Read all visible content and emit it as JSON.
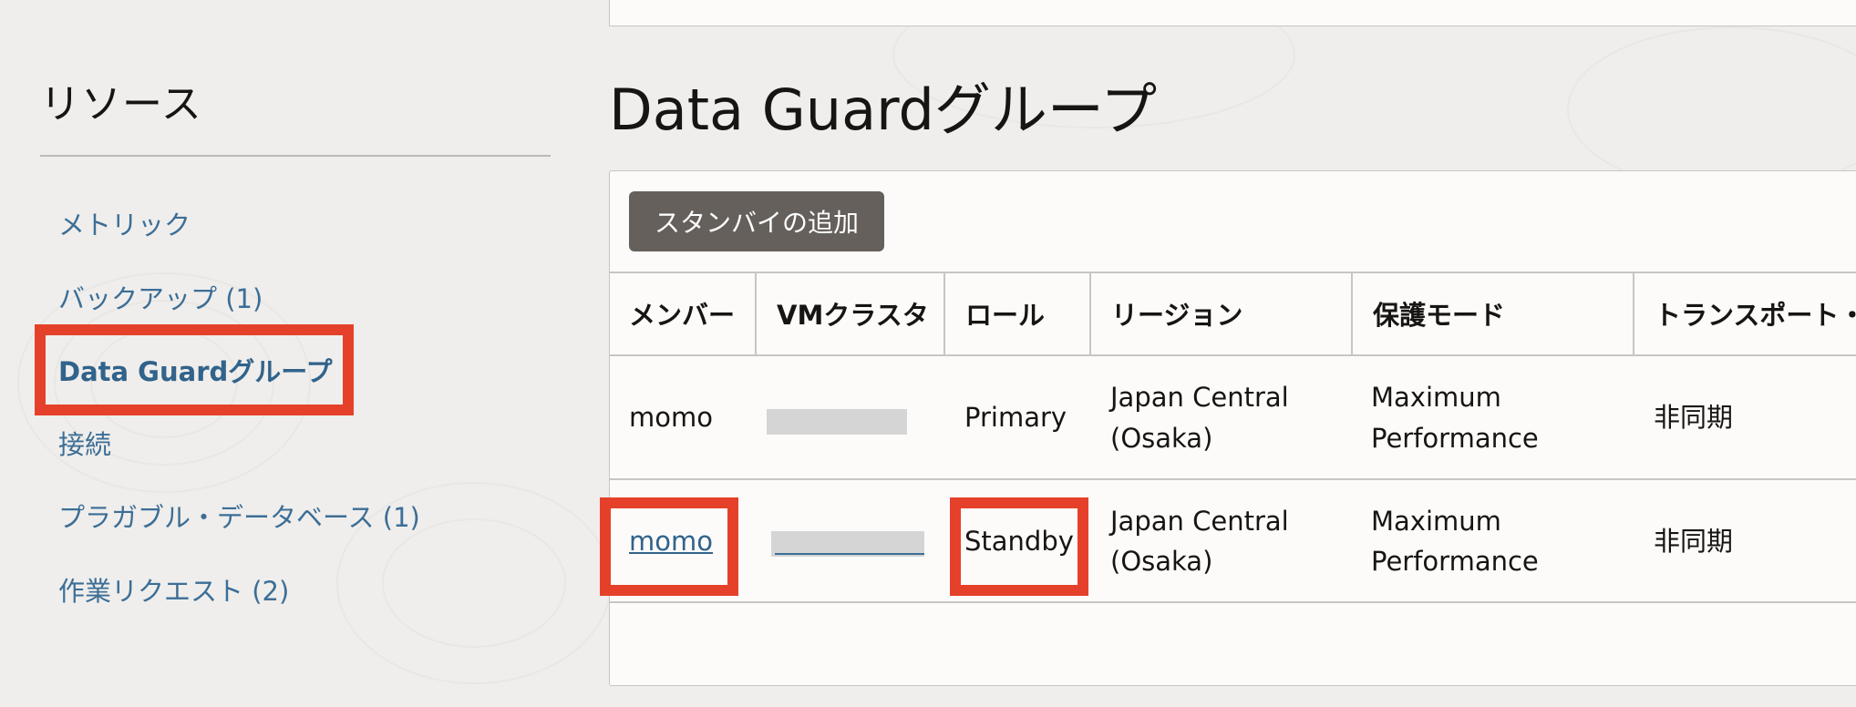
{
  "sidebar": {
    "title": "リソース",
    "items": [
      {
        "label": "メトリック"
      },
      {
        "label": "バックアップ (1)"
      },
      {
        "label": "Data Guardグループ",
        "active": true
      },
      {
        "label": "接続"
      },
      {
        "label": "プラガブル・データベース (1)"
      },
      {
        "label": "作業リクエスト (2)"
      }
    ]
  },
  "main": {
    "title": "Data Guardグループ",
    "add_button_label": "スタンバイの追加",
    "table": {
      "columns": [
        "メンバー",
        "VMクラスタ",
        "ロール",
        "リージョン",
        "保護モード",
        "トランスポート・タ"
      ],
      "rows": [
        {
          "member": "momo",
          "member_link": false,
          "vm_cluster": "",
          "role": "Primary",
          "region_l1": "Japan Central",
          "region_l2": "(Osaka)",
          "mode_l1": "Maximum",
          "mode_l2": "Performance",
          "transport": "非同期"
        },
        {
          "member": "momo",
          "member_link": true,
          "vm_cluster": "",
          "role": "Standby",
          "region_l1": "Japan Central",
          "region_l2": "(Osaka)",
          "mode_l1": "Maximum",
          "mode_l2": "Performance",
          "transport": "非同期"
        }
      ]
    }
  },
  "colors": {
    "highlight": "#e5412a",
    "link": "#31638b",
    "button": "#65605b"
  }
}
